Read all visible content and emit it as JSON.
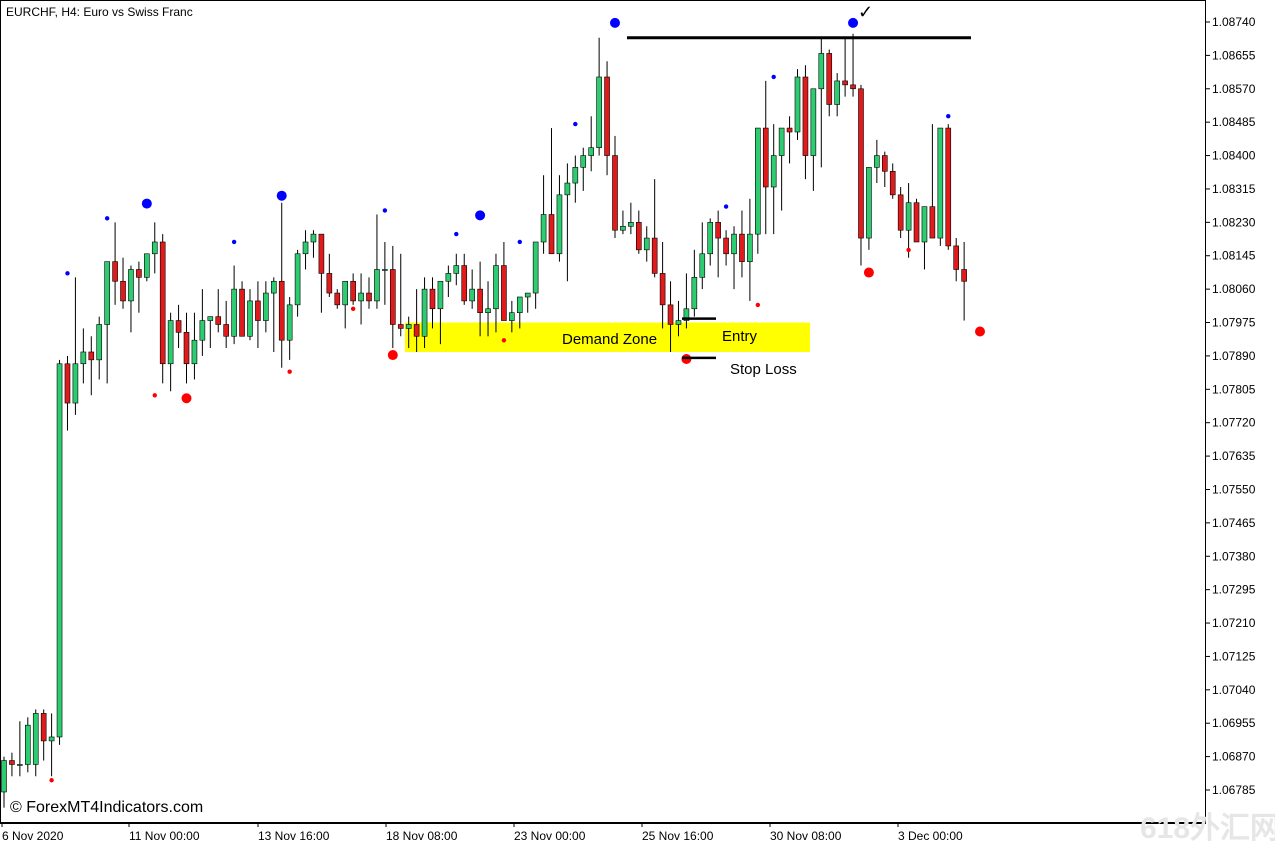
{
  "window": {
    "title": "EURCHF, H4:  Euro vs Swiss Franc"
  },
  "copyright": "© ForexMT4Indicators.com",
  "watermark": "618外汇网",
  "annotations": {
    "demand_zone": "Demand Zone",
    "entry": "Entry",
    "stop_loss": "Stop Loss",
    "checkmark": "✓"
  },
  "colors": {
    "bull": "#2ecc71",
    "bear": "#e01b1b",
    "zone": "#ffff00",
    "swing_high": "#0000ff",
    "swing_low": "#ff0000",
    "wick": "#000000"
  },
  "price_axis": [
    "1.08740",
    "1.08655",
    "1.08570",
    "1.08485",
    "1.08400",
    "1.08315",
    "1.08230",
    "1.08145",
    "1.08060",
    "1.07975",
    "1.07890",
    "1.07805",
    "1.07720",
    "1.07635",
    "1.07550",
    "1.07465",
    "1.07380",
    "1.07295",
    "1.07210",
    "1.07125",
    "1.07040",
    "1.06955",
    "1.06870",
    "1.06785"
  ],
  "time_axis": [
    "6 Nov 2020",
    "11 Nov 00:00",
    "13 Nov 16:00",
    "18 Nov 08:00",
    "23 Nov 00:00",
    "25 Nov 16:00",
    "30 Nov 08:00",
    "3 Dec 00:00"
  ],
  "chart_data": {
    "type": "candlestick",
    "symbol": "EURCHF",
    "timeframe": "H4",
    "ylim": [
      1.0674,
      1.0878
    ],
    "zone": {
      "low": 1.079,
      "high": 1.07975
    },
    "entry_price": 1.07985,
    "stop_price": 1.07885,
    "resistance_price": 1.087,
    "candles": [
      [
        1.0678,
        1.0687,
        1.0674,
        1.0686
      ],
      [
        1.0686,
        1.0688,
        1.0682,
        1.0685
      ],
      [
        1.0685,
        1.0696,
        1.0682,
        1.0685
      ],
      [
        1.0685,
        1.0697,
        1.0683,
        1.0695
      ],
      [
        1.0685,
        1.0699,
        1.0682,
        1.0698
      ],
      [
        1.0698,
        1.0699,
        1.0686,
        1.0691
      ],
      [
        1.0691,
        1.0698,
        1.0682,
        1.0692
      ],
      [
        1.0692,
        1.0788,
        1.069,
        1.0787
      ],
      [
        1.0787,
        1.0789,
        1.077,
        1.0777
      ],
      [
        1.0777,
        1.0809,
        1.0774,
        1.0787
      ],
      [
        1.0787,
        1.0796,
        1.0782,
        1.079
      ],
      [
        1.079,
        1.0794,
        1.0779,
        1.0788
      ],
      [
        1.0788,
        1.0799,
        1.0783,
        1.0797
      ],
      [
        1.0797,
        1.0813,
        1.0782,
        1.0813
      ],
      [
        1.0813,
        1.0823,
        1.0802,
        1.0808
      ],
      [
        1.0808,
        1.0814,
        1.0801,
        1.0803
      ],
      [
        1.0803,
        1.0812,
        1.0795,
        1.0811
      ],
      [
        1.0811,
        1.0813,
        1.08,
        1.0809
      ],
      [
        1.0809,
        1.0815,
        1.0808,
        1.0815
      ],
      [
        1.0815,
        1.0823,
        1.081,
        1.0818
      ],
      [
        1.0818,
        1.082,
        1.0782,
        1.0787
      ],
      [
        1.0787,
        1.08,
        1.078,
        1.0798
      ],
      [
        1.0798,
        1.0802,
        1.0791,
        1.0795
      ],
      [
        1.0795,
        1.08,
        1.0782,
        1.0787
      ],
      [
        1.0787,
        1.08,
        1.0783,
        1.0793
      ],
      [
        1.0793,
        1.0806,
        1.0789,
        1.0798
      ],
      [
        1.0798,
        1.0799,
        1.0791,
        1.0799
      ],
      [
        1.0799,
        1.0806,
        1.0795,
        1.0797
      ],
      [
        1.0797,
        1.0803,
        1.0791,
        1.0794
      ],
      [
        1.0794,
        1.0812,
        1.0792,
        1.0806
      ],
      [
        1.0806,
        1.0808,
        1.0794,
        1.0794
      ],
      [
        1.0794,
        1.0806,
        1.0793,
        1.0803
      ],
      [
        1.0803,
        1.0808,
        1.0791,
        1.0798
      ],
      [
        1.0798,
        1.0808,
        1.0795,
        1.0805
      ],
      [
        1.0805,
        1.0809,
        1.079,
        1.0808
      ],
      [
        1.0808,
        1.0828,
        1.0786,
        1.0793
      ],
      [
        1.0793,
        1.0804,
        1.0788,
        1.0802
      ],
      [
        1.0802,
        1.0816,
        1.0799,
        1.0815
      ],
      [
        1.0815,
        1.0821,
        1.0811,
        1.0818
      ],
      [
        1.0818,
        1.0821,
        1.0814,
        1.082
      ],
      [
        1.082,
        1.082,
        1.08,
        1.081
      ],
      [
        1.081,
        1.0815,
        1.0804,
        1.0805
      ],
      [
        1.0805,
        1.0806,
        1.0801,
        1.0802
      ],
      [
        1.0802,
        1.0805,
        1.0796,
        1.0808
      ],
      [
        1.0808,
        1.081,
        1.0802,
        1.0803
      ],
      [
        1.0803,
        1.081,
        1.0797,
        1.0805
      ],
      [
        1.0805,
        1.0809,
        1.0801,
        1.0803
      ],
      [
        1.0803,
        1.0825,
        1.0801,
        1.0811
      ],
      [
        1.0811,
        1.0818,
        1.0802,
        1.0811
      ],
      [
        1.0811,
        1.0817,
        1.0791,
        1.0797
      ],
      [
        1.0797,
        1.0815,
        1.0794,
        1.0796
      ],
      [
        1.0796,
        1.0799,
        1.0791,
        1.0797
      ],
      [
        1.0797,
        1.0806,
        1.079,
        1.0794
      ],
      [
        1.0794,
        1.0809,
        1.0791,
        1.0806
      ],
      [
        1.0806,
        1.0809,
        1.0796,
        1.0801
      ],
      [
        1.0801,
        1.0805,
        1.0792,
        1.0808
      ],
      [
        1.0808,
        1.0812,
        1.0804,
        1.081
      ],
      [
        1.081,
        1.0815,
        1.0807,
        1.0812
      ],
      [
        1.0812,
        1.0815,
        1.0802,
        1.0803
      ],
      [
        1.0803,
        1.0811,
        1.0801,
        1.0806
      ],
      [
        1.0806,
        1.0813,
        1.0794,
        1.08
      ],
      [
        1.08,
        1.0808,
        1.0794,
        1.0801
      ],
      [
        1.0801,
        1.0815,
        1.0795,
        1.0812
      ],
      [
        1.0812,
        1.0818,
        1.08,
        1.0798
      ],
      [
        1.0798,
        1.0803,
        1.0795,
        1.08
      ],
      [
        1.08,
        1.0802,
        1.0796,
        1.0804
      ],
      [
        1.0804,
        1.0805,
        1.08,
        1.0805
      ],
      [
        1.0805,
        1.0812,
        1.0801,
        1.0818
      ],
      [
        1.0818,
        1.0835,
        1.0815,
        1.0825
      ],
      [
        1.0825,
        1.0847,
        1.0819,
        1.0815
      ],
      [
        1.0815,
        1.0835,
        1.0813,
        1.083
      ],
      [
        1.083,
        1.0838,
        1.0808,
        1.0833
      ],
      [
        1.0833,
        1.084,
        1.0828,
        1.0837
      ],
      [
        1.0837,
        1.0842,
        1.0831,
        1.084
      ],
      [
        1.084,
        1.085,
        1.0836,
        1.0842
      ],
      [
        1.0842,
        1.087,
        1.084,
        1.086
      ],
      [
        1.086,
        1.0864,
        1.0835,
        1.084
      ],
      [
        1.084,
        1.0845,
        1.0819,
        1.0821
      ],
      [
        1.0821,
        1.0826,
        1.082,
        1.0822
      ],
      [
        1.0822,
        1.0828,
        1.082,
        1.0823
      ],
      [
        1.0823,
        1.0826,
        1.0815,
        1.0816
      ],
      [
        1.0816,
        1.0822,
        1.0813,
        1.0819
      ],
      [
        1.0819,
        1.0834,
        1.0809,
        1.081
      ],
      [
        1.081,
        1.0818,
        1.0796,
        1.0802
      ],
      [
        1.0802,
        1.0808,
        1.079,
        1.0797
      ],
      [
        1.0797,
        1.0803,
        1.0794,
        1.0798
      ],
      [
        1.0798,
        1.081,
        1.0796,
        1.0801
      ],
      [
        1.0801,
        1.0816,
        1.0799,
        1.0809
      ],
      [
        1.0809,
        1.0823,
        1.0806,
        1.0815
      ],
      [
        1.0815,
        1.0824,
        1.0812,
        1.0823
      ],
      [
        1.0823,
        1.0826,
        1.0809,
        1.0819
      ],
      [
        1.0819,
        1.0821,
        1.0812,
        1.0815
      ],
      [
        1.0815,
        1.0822,
        1.0806,
        1.082
      ],
      [
        1.082,
        1.0826,
        1.0809,
        1.0813
      ],
      [
        1.0813,
        1.0829,
        1.0803,
        1.082
      ],
      [
        1.082,
        1.0847,
        1.0815,
        1.0847
      ],
      [
        1.0847,
        1.0859,
        1.082,
        1.0832
      ],
      [
        1.0832,
        1.0848,
        1.082,
        1.084
      ],
      [
        1.084,
        1.0843,
        1.0826,
        1.0847
      ],
      [
        1.0847,
        1.085,
        1.0838,
        1.0846
      ],
      [
        1.0846,
        1.0862,
        1.0844,
        1.086
      ],
      [
        1.086,
        1.0863,
        1.0834,
        1.084
      ],
      [
        1.084,
        1.0851,
        1.0831,
        1.0857
      ],
      [
        1.0857,
        1.087,
        1.0837,
        1.0866
      ],
      [
        1.0866,
        1.0867,
        1.085,
        1.0853
      ],
      [
        1.0853,
        1.0861,
        1.085,
        1.0859
      ],
      [
        1.0859,
        1.087,
        1.0855,
        1.0858
      ],
      [
        1.0858,
        1.0871,
        1.0855,
        1.0857
      ],
      [
        1.0857,
        1.0858,
        1.0812,
        1.0819
      ],
      [
        1.0819,
        1.0837,
        1.0816,
        1.0837
      ],
      [
        1.0837,
        1.0844,
        1.0833,
        1.084
      ],
      [
        1.084,
        1.0841,
        1.0832,
        1.0836
      ],
      [
        1.0836,
        1.0838,
        1.0829,
        1.083
      ],
      [
        1.083,
        1.0832,
        1.0819,
        1.0821
      ],
      [
        1.0821,
        1.0833,
        1.0814,
        1.0828
      ],
      [
        1.0828,
        1.0829,
        1.0818,
        1.0818
      ],
      [
        1.0818,
        1.0826,
        1.0811,
        1.0827
      ],
      [
        1.0827,
        1.0848,
        1.082,
        1.0819
      ],
      [
        1.0819,
        1.0847,
        1.0817,
        1.0847
      ],
      [
        1.0847,
        1.0848,
        1.0816,
        1.0817
      ],
      [
        1.0817,
        1.0819,
        1.0808,
        1.0811
      ],
      [
        1.0811,
        1.0818,
        1.0798,
        1.0808
      ]
    ],
    "swing_points": [
      {
        "i": 6,
        "type": "low",
        "size": "small",
        "price": 1.0682
      },
      {
        "i": 8,
        "type": "high",
        "size": "small",
        "price": 1.0809
      },
      {
        "i": 13,
        "type": "high",
        "size": "small",
        "price": 1.0823
      },
      {
        "i": 18,
        "type": "high",
        "size": "large",
        "price": 1.0826
      },
      {
        "i": 19,
        "type": "low",
        "size": "small",
        "price": 1.078
      },
      {
        "i": 23,
        "type": "low",
        "size": "large",
        "price": 1.078
      },
      {
        "i": 29,
        "type": "high",
        "size": "small",
        "price": 1.0817
      },
      {
        "i": 35,
        "type": "high",
        "size": "large",
        "price": 1.0828
      },
      {
        "i": 36,
        "type": "low",
        "size": "small",
        "price": 1.0786
      },
      {
        "i": 44,
        "type": "low",
        "size": "small",
        "price": 1.0802
      },
      {
        "i": 48,
        "type": "high",
        "size": "small",
        "price": 1.0825
      },
      {
        "i": 49,
        "type": "low",
        "size": "large",
        "price": 1.0791
      },
      {
        "i": 57,
        "type": "high",
        "size": "small",
        "price": 1.0819
      },
      {
        "i": 60,
        "type": "high",
        "size": "large",
        "price": 1.0823
      },
      {
        "i": 63,
        "type": "low",
        "size": "small",
        "price": 1.0794
      },
      {
        "i": 65,
        "type": "high",
        "size": "small",
        "price": 1.0817
      },
      {
        "i": 72,
        "type": "high",
        "size": "small",
        "price": 1.0847
      },
      {
        "i": 77,
        "type": "high",
        "size": "large",
        "price": 1.0872
      },
      {
        "i": 86,
        "type": "low",
        "size": "large",
        "price": 1.079
      },
      {
        "i": 91,
        "type": "high",
        "size": "small",
        "price": 1.0826
      },
      {
        "i": 95,
        "type": "low",
        "size": "small",
        "price": 1.0803
      },
      {
        "i": 97,
        "type": "high",
        "size": "small",
        "price": 1.0859
      },
      {
        "i": 107,
        "type": "high",
        "size": "large",
        "price": 1.0872
      },
      {
        "i": 109,
        "type": "low",
        "size": "large",
        "price": 1.0812
      },
      {
        "i": 114,
        "type": "low",
        "size": "small",
        "price": 1.0817
      },
      {
        "i": 119,
        "type": "high",
        "size": "small",
        "price": 1.0849
      },
      {
        "i": 123,
        "type": "low",
        "size": "large",
        "price": 1.0797
      }
    ]
  }
}
